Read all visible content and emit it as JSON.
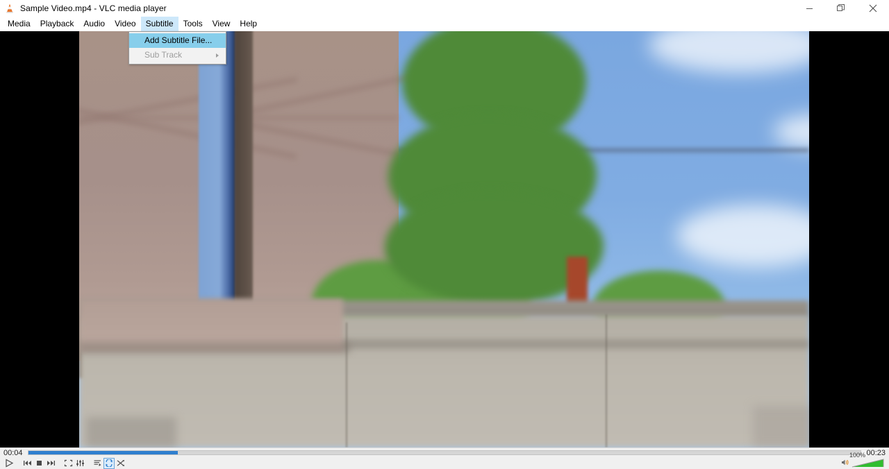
{
  "window": {
    "title": "Sample Video.mp4 - VLC media player",
    "app_icon": "vlc-cone-icon",
    "minimize_label": "Minimize",
    "restore_label": "Restore",
    "close_label": "Close"
  },
  "menubar": {
    "items": [
      {
        "label": "Media",
        "active": false
      },
      {
        "label": "Playback",
        "active": false
      },
      {
        "label": "Audio",
        "active": false
      },
      {
        "label": "Video",
        "active": false
      },
      {
        "label": "Subtitle",
        "active": true
      },
      {
        "label": "Tools",
        "active": false
      },
      {
        "label": "View",
        "active": false
      },
      {
        "label": "Help",
        "active": false
      }
    ]
  },
  "dropdown": {
    "open_menu": "Subtitle",
    "items": [
      {
        "label": "Add Subtitle File...",
        "state": "highlighted",
        "submenu": false
      },
      {
        "label": "Sub Track",
        "state": "disabled",
        "submenu": true
      }
    ]
  },
  "playback": {
    "elapsed": "00:04",
    "total": "00:23",
    "progress_percent": 18,
    "seek_fill_color": "#2f7fcf"
  },
  "controls": {
    "buttons": [
      {
        "name": "play-button",
        "label": "Play",
        "state": "normal"
      },
      {
        "name": "previous-button",
        "label": "Previous",
        "state": "normal"
      },
      {
        "name": "stop-button",
        "label": "Stop",
        "state": "normal"
      },
      {
        "name": "next-button",
        "label": "Next",
        "state": "normal"
      },
      {
        "name": "fullscreen-button",
        "label": "Toggle fullscreen",
        "state": "normal"
      },
      {
        "name": "extended-settings-button",
        "label": "Show extended settings",
        "state": "normal"
      },
      {
        "name": "playlist-button",
        "label": "Show playlist",
        "state": "normal"
      },
      {
        "name": "loop-button",
        "label": "Loop",
        "state": "active"
      },
      {
        "name": "shuffle-button",
        "label": "Random",
        "state": "normal"
      }
    ]
  },
  "volume": {
    "level_label": "100%",
    "level_percent": 100,
    "icon": "speaker-icon",
    "fill_color": "#2fbd2f"
  },
  "video": {
    "description": "Blurred animated outdoor scene: tan building wall with blue window column on the left, large green tree with reddish trunk in the center, blue sky with white clouds on the right, green bushes and grey pavement along the bottom",
    "letterbox_color": "#000000",
    "sky_color": "#80ace2",
    "wall_color": "#a89287",
    "tree_color": "#4f8a38",
    "trunk_color": "#a6472b",
    "ground_color": "#b8b4ac"
  }
}
